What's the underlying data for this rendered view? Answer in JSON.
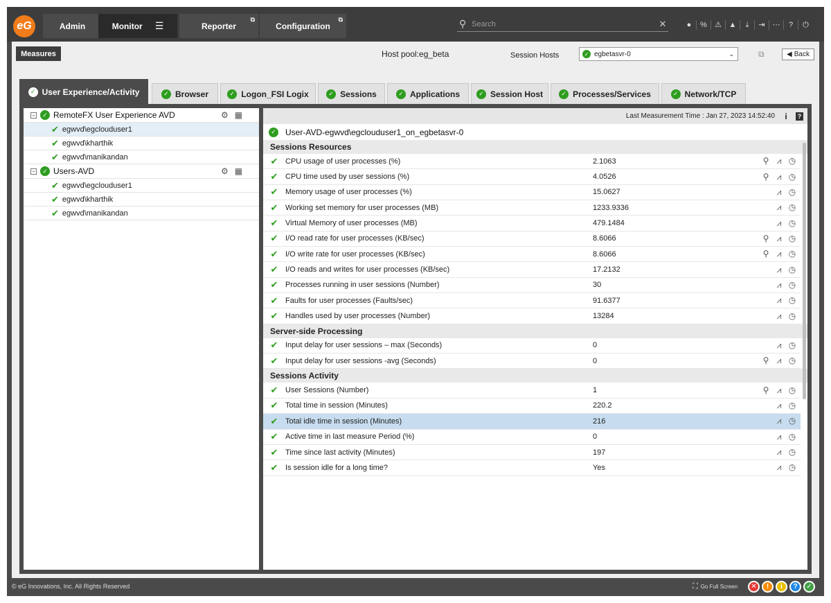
{
  "nav": {
    "logo_text": "eG",
    "tabs": [
      {
        "label": "Admin"
      },
      {
        "label": "Monitor"
      },
      {
        "label": "Reporter"
      },
      {
        "label": "Configuration"
      }
    ],
    "search_placeholder": "Search",
    "icons": [
      "user-icon",
      "link-icon",
      "alarm-icon",
      "bell-icon",
      "download-icon",
      "logout-icon",
      "more-icon",
      "help-icon",
      "power-icon"
    ]
  },
  "toolbar": {
    "measures_label": "Measures",
    "host_pool": "Host pool:eg_beta",
    "session_hosts_label": "Session Hosts",
    "selected_host": "egbetasvr-0",
    "back_label": "Back"
  },
  "component_tabs": [
    {
      "label": "User Experience/Activity",
      "active": true
    },
    {
      "label": "Browser"
    },
    {
      "label": "Logon_FSI Logix"
    },
    {
      "label": "Sessions"
    },
    {
      "label": "Applications"
    },
    {
      "label": "Session Host"
    },
    {
      "label": "Processes/Services"
    },
    {
      "label": "Network/TCP"
    }
  ],
  "tree": [
    {
      "label": "RemoteFX User Experience AVD",
      "items": [
        "egwvd\\egclouduser1",
        "egwvd\\kharthik",
        "egwvd\\manikandan"
      ]
    },
    {
      "label": "Users-AVD",
      "items": [
        "egwvd\\egclouduser1",
        "egwvd\\kharthik",
        "egwvd\\manikandan"
      ]
    }
  ],
  "detail": {
    "last_measurement": "Last Measurement Time : Jan 27, 2023 14:52:40",
    "title": "User-AVD-egwvd\\egclouduser1_on_egbetasvr-0",
    "sections": [
      {
        "title": "Sessions Resources",
        "rows": [
          {
            "name": "CPU usage of user processes (%)",
            "value": "2.1063",
            "zoom": true
          },
          {
            "name": "CPU time used by user sessions (%)",
            "value": "4.0526",
            "zoom": true
          },
          {
            "name": "Memory usage of user processes (%)",
            "value": "15.0627"
          },
          {
            "name": "Working set memory for user processes (MB)",
            "value": "1233.9336"
          },
          {
            "name": "Virtual Memory of user processes (MB)",
            "value": "479.1484"
          },
          {
            "name": "I/O read rate for user processes (KB/sec)",
            "value": "8.6066",
            "zoom": true
          },
          {
            "name": "I/O write rate for user processes (KB/sec)",
            "value": "8.6066",
            "zoom": true
          },
          {
            "name": "I/O reads and writes for user processes (KB/sec)",
            "value": "17.2132"
          },
          {
            "name": "Processes running in user sessions (Number)",
            "value": "30"
          },
          {
            "name": "Faults for user processes (Faults/sec)",
            "value": "91.6377"
          },
          {
            "name": "Handles used by user processes (Number)",
            "value": "13284"
          }
        ]
      },
      {
        "title": "Server-side Processing",
        "rows": [
          {
            "name": "Input delay for user sessions – max (Seconds)",
            "value": "0"
          },
          {
            "name": "Input delay for user sessions -avg (Seconds)",
            "value": "0",
            "zoom": true
          }
        ]
      },
      {
        "title": "Sessions Activity",
        "rows": [
          {
            "name": "User Sessions (Number)",
            "value": "1",
            "zoom": true
          },
          {
            "name": "Total time in session (Minutes)",
            "value": "220.2"
          },
          {
            "name": "Total idle time in session (Minutes)",
            "value": "216",
            "highlight": true
          },
          {
            "name": "Active time in last measure Period (%)",
            "value": "0"
          },
          {
            "name": "Time since last activity (Minutes)",
            "value": "197"
          },
          {
            "name": "Is session idle for a long time?",
            "value": "Yes"
          }
        ]
      }
    ]
  },
  "footer": {
    "copyright": "© eG Innovations, Inc. All Rights Reserved",
    "fullscreen_label": "Go Full Screen",
    "status_colors": [
      "#e53935",
      "#fb8c00",
      "#e6c000",
      "#1e88e5",
      "#43a047"
    ],
    "status_glyphs": [
      "✕",
      "!",
      "i",
      "?",
      "✓"
    ]
  }
}
